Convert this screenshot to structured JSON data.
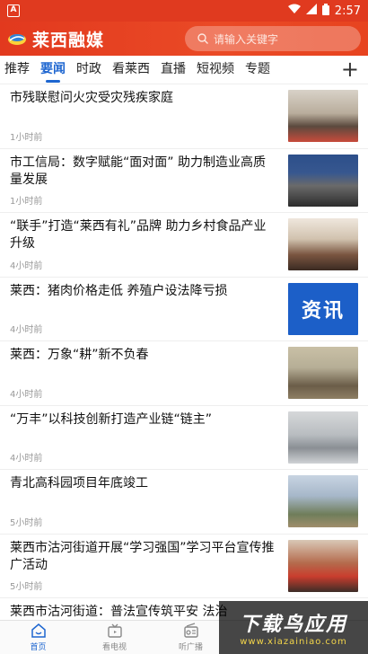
{
  "status_bar": {
    "badge": "A",
    "time": "2:57"
  },
  "header": {
    "app_name": "莱西融媒",
    "search_placeholder": "请输入关键字"
  },
  "tabs": [
    {
      "label": "推荐",
      "active": false
    },
    {
      "label": "要闻",
      "active": true
    },
    {
      "label": "时政",
      "active": false
    },
    {
      "label": "看莱西",
      "active": false
    },
    {
      "label": "直播",
      "active": false
    },
    {
      "label": "短视频",
      "active": false
    },
    {
      "label": "专题",
      "active": false
    }
  ],
  "tabs_add_label": "+",
  "news": [
    {
      "title": "市残联慰问火灾受灾残疾家庭",
      "time": "1小时前"
    },
    {
      "title": "市工信局：数字赋能“面对面” 助力制造业高质量发展",
      "time": "1小时前"
    },
    {
      "title": "“联手”打造“莱西有礼”品牌 助力乡村食品产业升级",
      "time": "4小时前"
    },
    {
      "title": "莱西：猪肉价格走低 养殖户设法降亏损",
      "time": "4小时前",
      "thumb_text": "资讯"
    },
    {
      "title": "莱西：万象“耕”新不负春",
      "time": "4小时前"
    },
    {
      "title": "“万丰”以科技创新打造产业链“链主”",
      "time": "4小时前"
    },
    {
      "title": "青北高科园项目年底竣工",
      "time": "5小时前"
    },
    {
      "title": "莱西市沽河街道开展“学习强国”学习平台宣传推广活动",
      "time": "5小时前"
    },
    {
      "title": "莱西市沽河街道：普法宣传筑平安 法治",
      "time": ""
    }
  ],
  "bottom_nav": [
    {
      "label": "首页",
      "icon": "home-icon",
      "active": true
    },
    {
      "label": "看电视",
      "icon": "tv-icon",
      "active": false
    },
    {
      "label": "听广播",
      "icon": "radio-icon",
      "active": false
    }
  ],
  "watermark": {
    "title": "下载鸟应用",
    "url": "www.xiazainiao.com"
  },
  "colors": {
    "brand_red": "#e2391e",
    "active_blue": "#1e66d0"
  }
}
